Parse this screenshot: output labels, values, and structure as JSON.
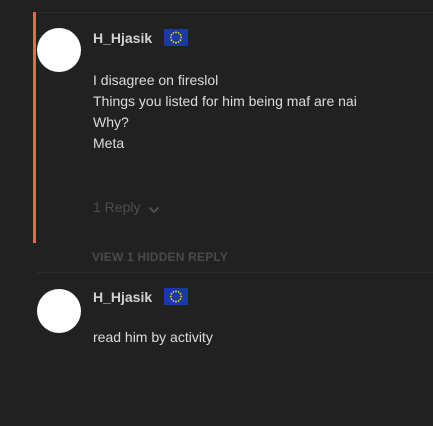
{
  "comments": [
    {
      "username": "H_Hjasik",
      "flag_icon": "eu-flag-icon",
      "lines": [
        "I disagree on fireslol",
        "Things you listed for him being maf are nai",
        "Why?",
        "Meta"
      ],
      "reply_label": "1 Reply"
    },
    {
      "username": "H_Hjasik",
      "flag_icon": "eu-flag-icon",
      "lines": [
        "read him by activity"
      ]
    }
  ],
  "hidden_reply_label": "VIEW 1 HIDDEN REPLY",
  "colors": {
    "background": "#212121",
    "thread_accent": "#e8684a",
    "flag_blue": "#1a3aa8",
    "flag_star": "#f5d90a"
  }
}
